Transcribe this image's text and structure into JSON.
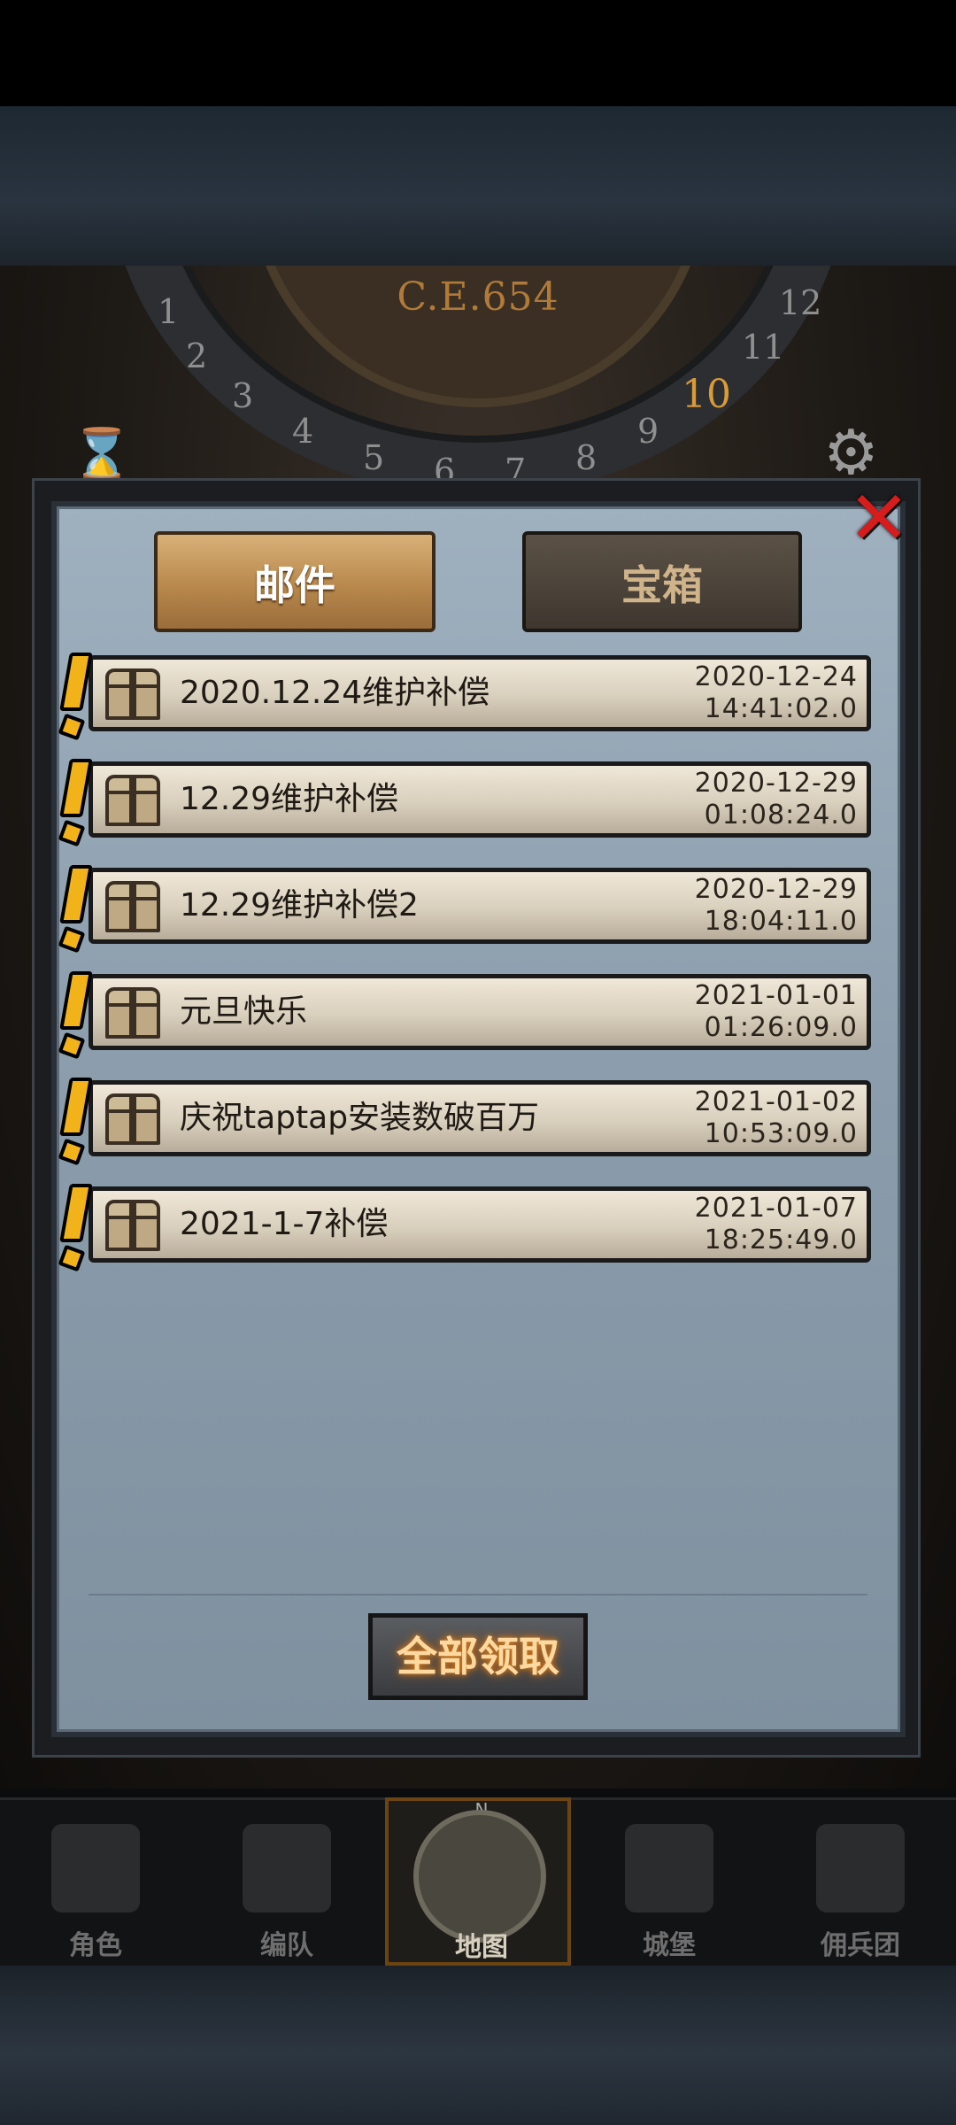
{
  "header": {
    "era": "C.E.654",
    "dial_numbers": [
      "1",
      "2",
      "3",
      "4",
      "5",
      "6",
      "7",
      "8",
      "9",
      "10",
      "11",
      "12"
    ],
    "current_month": "10"
  },
  "tabs": [
    {
      "label": "邮件",
      "active": true
    },
    {
      "label": "宝箱",
      "active": false
    }
  ],
  "mails": [
    {
      "subject": "2020.12.24维护补偿",
      "date": "2020-12-24",
      "time": "14:41:02.0"
    },
    {
      "subject": "12.29维护补偿",
      "date": "2020-12-29",
      "time": "01:08:24.0"
    },
    {
      "subject": "12.29维护补偿2",
      "date": "2020-12-29",
      "time": "18:04:11.0"
    },
    {
      "subject": "元旦快乐",
      "date": "2021-01-01",
      "time": "01:26:09.0"
    },
    {
      "subject": "庆祝taptap安装数破百万",
      "date": "2021-01-02",
      "time": "10:53:09.0"
    },
    {
      "subject": "2021-1-7补偿",
      "date": "2021-01-07",
      "time": "18:25:49.0"
    }
  ],
  "claim_all_label": "全部领取",
  "nav": [
    {
      "label": "角色",
      "icon": "knight-icon",
      "active": false
    },
    {
      "label": "编队",
      "icon": "troops-icon",
      "active": false
    },
    {
      "label": "地图",
      "icon": "compass-map-icon",
      "active": true
    },
    {
      "label": "城堡",
      "icon": "castle-icon",
      "active": false
    },
    {
      "label": "佣兵团",
      "icon": "mercenary-ship-icon",
      "active": false
    }
  ],
  "colors": {
    "accent_gold": "#b8884c",
    "alert_yellow": "#f2b21a",
    "close_red": "#d61c1c",
    "panel_blue": "#8a9cab"
  }
}
